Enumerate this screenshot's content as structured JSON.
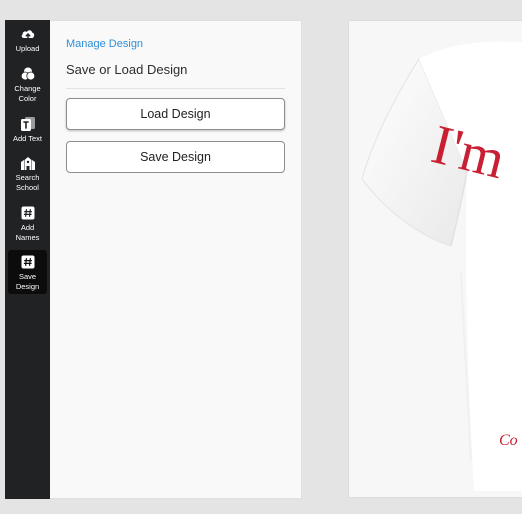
{
  "sidebar": {
    "items": [
      {
        "label": "Upload",
        "icon": "upload-icon"
      },
      {
        "label": "Change\nColor",
        "icon": "color-icon"
      },
      {
        "label": "Add Text",
        "icon": "text-icon"
      },
      {
        "label": "Search\nSchool",
        "icon": "school-icon"
      },
      {
        "label": "Add\nNames",
        "icon": "hash-icon"
      },
      {
        "label": "Save\nDesign",
        "icon": "hash-icon",
        "active": true
      }
    ]
  },
  "panel": {
    "breadcrumb": "Manage Design",
    "title": "Save or Load Design",
    "load_label": "Load Design",
    "save_label": "Save Design"
  },
  "preview": {
    "shirt_color": "#ffffff",
    "print_color": "#c81f33",
    "print_text_large": "I'm",
    "print_text_small": "Co"
  },
  "colors": {
    "sidebar_bg": "#212224",
    "accent": "#2e8fd6"
  }
}
